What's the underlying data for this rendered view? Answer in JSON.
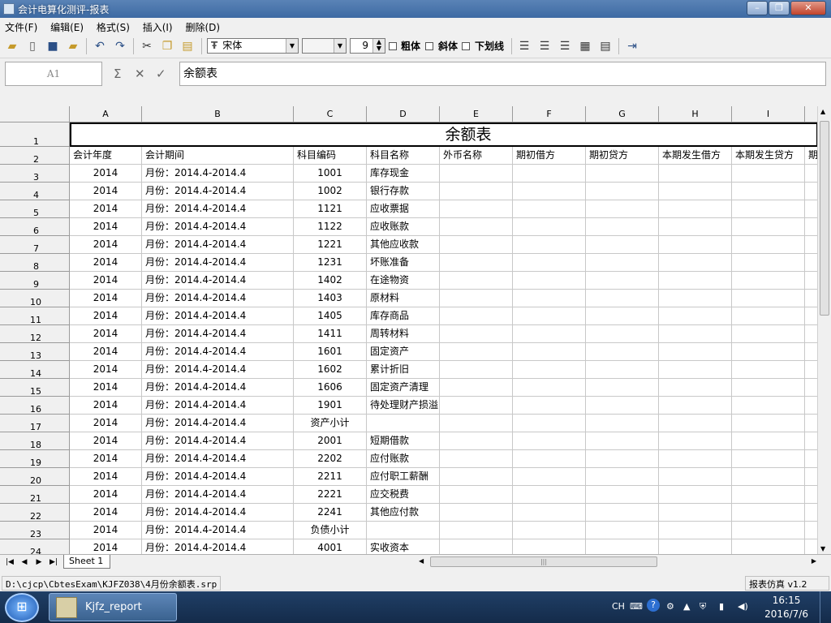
{
  "window": {
    "title": "会计电算化测评-报表"
  },
  "menu": [
    "文件(F)",
    "编辑(E)",
    "格式(S)",
    "插入(I)",
    "删除(D)"
  ],
  "toolbar": {
    "font_name": "宋体",
    "font_size": "9",
    "bold_label": "粗体",
    "italic_label": "斜体",
    "underline_label": "下划线"
  },
  "formula": {
    "cell_ref": "A1",
    "sum_symbol": "Σ",
    "cancel_symbol": "✕",
    "accept_symbol": "✓",
    "content": "余额表"
  },
  "columns": [
    "A",
    "B",
    "C",
    "D",
    "E",
    "F",
    "G",
    "H",
    "I"
  ],
  "sheet": {
    "title": "余额表",
    "headers": [
      "会计年度",
      "会计期间",
      "科目编码",
      "科目名称",
      "外币名称",
      "期初借方",
      "期初贷方",
      "本期发生借方",
      "本期发生贷方",
      "期"
    ],
    "rows": [
      [
        "2014",
        "月份：2014.4-2014.4",
        "1001",
        "库存现金"
      ],
      [
        "2014",
        "月份：2014.4-2014.4",
        "1002",
        "银行存款"
      ],
      [
        "2014",
        "月份：2014.4-2014.4",
        "1121",
        "应收票据"
      ],
      [
        "2014",
        "月份：2014.4-2014.4",
        "1122",
        "应收账款"
      ],
      [
        "2014",
        "月份：2014.4-2014.4",
        "1221",
        "其他应收款"
      ],
      [
        "2014",
        "月份：2014.4-2014.4",
        "1231",
        "坏账准备"
      ],
      [
        "2014",
        "月份：2014.4-2014.4",
        "1402",
        "在途物资"
      ],
      [
        "2014",
        "月份：2014.4-2014.4",
        "1403",
        "原材料"
      ],
      [
        "2014",
        "月份：2014.4-2014.4",
        "1405",
        "库存商品"
      ],
      [
        "2014",
        "月份：2014.4-2014.4",
        "1411",
        "周转材料"
      ],
      [
        "2014",
        "月份：2014.4-2014.4",
        "1601",
        "固定资产"
      ],
      [
        "2014",
        "月份：2014.4-2014.4",
        "1602",
        "累计折旧"
      ],
      [
        "2014",
        "月份：2014.4-2014.4",
        "1606",
        "固定资产清理"
      ],
      [
        "2014",
        "月份：2014.4-2014.4",
        "1901",
        "待处理财产损溢"
      ],
      [
        "2014",
        "月份：2014.4-2014.4",
        "资产小计",
        ""
      ],
      [
        "2014",
        "月份：2014.4-2014.4",
        "2001",
        "短期借款"
      ],
      [
        "2014",
        "月份：2014.4-2014.4",
        "2202",
        "应付账款"
      ],
      [
        "2014",
        "月份：2014.4-2014.4",
        "2211",
        "应付职工薪酬"
      ],
      [
        "2014",
        "月份：2014.4-2014.4",
        "2221",
        "应交税费"
      ],
      [
        "2014",
        "月份：2014.4-2014.4",
        "2241",
        "其他应付款"
      ],
      [
        "2014",
        "月份：2014.4-2014.4",
        "负债小计",
        ""
      ],
      [
        "2014",
        "月份：2014.4-2014.4",
        "4001",
        "实收资本"
      ]
    ]
  },
  "sheet_tabs": [
    "Sheet 1"
  ],
  "status": {
    "path": "D:\\cjcp\\CbtesExam\\KJFZ038\\4月份余额表.srp",
    "version": "报表仿真 v1.2"
  },
  "taskbar": {
    "item": "Kjfz_report",
    "lang": "CH",
    "time": "16:15",
    "date": "2016/7/6"
  }
}
